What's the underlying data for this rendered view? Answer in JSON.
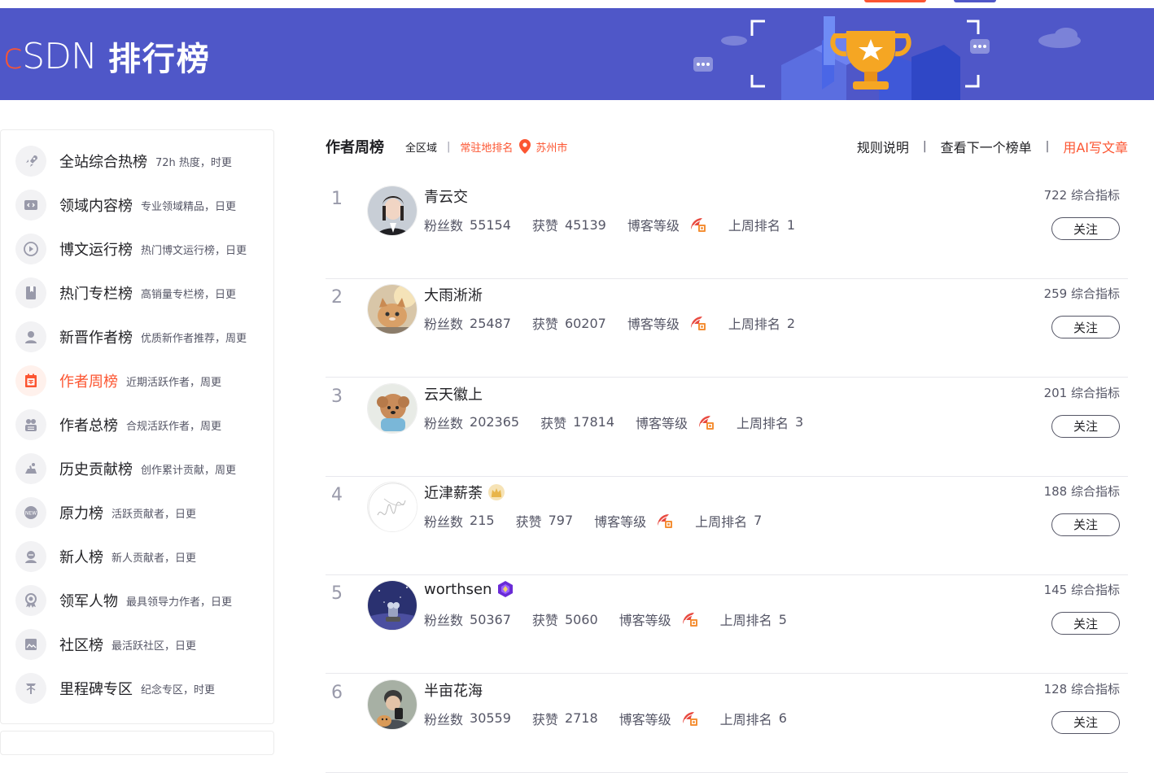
{
  "header": {
    "logo_c": "c",
    "logo_sdn": "SDN",
    "title": "排行榜",
    "colors": {
      "banner": "#4f57c8",
      "accent": "#fc5531"
    }
  },
  "sidebar": {
    "items": [
      {
        "label": "全站综合热榜",
        "desc": "72h 热度，时更",
        "icon": "rocket-icon",
        "active": false
      },
      {
        "label": "领域内容榜",
        "desc": "专业领域精品，日更",
        "icon": "code-icon",
        "active": false
      },
      {
        "label": "博文运行榜",
        "desc": "热门博文运行榜，日更",
        "icon": "play-icon",
        "active": false
      },
      {
        "label": "热门专栏榜",
        "desc": "高销量专栏榜，日更",
        "icon": "book-icon",
        "active": false
      },
      {
        "label": "新晋作者榜",
        "desc": "优质新作者推荐，周更",
        "icon": "user-icon",
        "active": false
      },
      {
        "label": "作者周榜",
        "desc": "近期活跃作者，周更",
        "icon": "calendar-icon",
        "active": true
      },
      {
        "label": "作者总榜",
        "desc": "合规活跃作者，周更",
        "icon": "users-icon",
        "active": false
      },
      {
        "label": "历史贡献榜",
        "desc": "创作累计贡献，周更",
        "icon": "hand-icon",
        "active": false
      },
      {
        "label": "原力榜",
        "desc": "活跃贡献者，日更",
        "icon": "new-icon",
        "active": false
      },
      {
        "label": "新人榜",
        "desc": "新人贡献者，日更",
        "icon": "newbie-icon",
        "active": false
      },
      {
        "label": "领军人物",
        "desc": "最具领导力作者，日更",
        "icon": "medal-icon",
        "active": false
      },
      {
        "label": "社区榜",
        "desc": "最活跃社区，日更",
        "icon": "community-icon",
        "active": false
      },
      {
        "label": "里程碑专区",
        "desc": "纪念专区，时更",
        "icon": "milestone-icon",
        "active": false
      }
    ]
  },
  "main": {
    "title": "作者周榜",
    "region": "全区域",
    "sep": "|",
    "resident": "常驻地排名",
    "city": "苏州市",
    "links": {
      "rules": "规则说明",
      "next": "查看下一个榜单",
      "ai": "用AI写文章"
    },
    "labels": {
      "fans": "粉丝数",
      "likes": "获赞",
      "level": "博客等级",
      "last_rank": "上周排名",
      "score_suffix": "综合指标",
      "follow": "关注"
    },
    "rows": [
      {
        "rank": "1",
        "name": "青云交",
        "fans": "55154",
        "likes": "45139",
        "last_rank": "1",
        "score": "722 综合指标",
        "badge": ""
      },
      {
        "rank": "2",
        "name": "大雨淅淅",
        "fans": "25487",
        "likes": "60207",
        "last_rank": "2",
        "score": "259 综合指标",
        "badge": ""
      },
      {
        "rank": "3",
        "name": "云天徽上",
        "fans": "202365",
        "likes": "17814",
        "last_rank": "3",
        "score": "201 综合指标",
        "badge": ""
      },
      {
        "rank": "4",
        "name": "近津薪荼",
        "fans": "215",
        "likes": "797",
        "last_rank": "7",
        "score": "188 综合指标",
        "badge": "crown-badge-icon"
      },
      {
        "rank": "5",
        "name": "worthsen",
        "fans": "50367",
        "likes": "5060",
        "last_rank": "5",
        "score": "145 综合指标",
        "badge": "hexagon-badge-icon"
      },
      {
        "rank": "6",
        "name": "半亩花海",
        "fans": "30559",
        "likes": "2718",
        "last_rank": "6",
        "score": "128 综合指标",
        "badge": ""
      }
    ]
  }
}
